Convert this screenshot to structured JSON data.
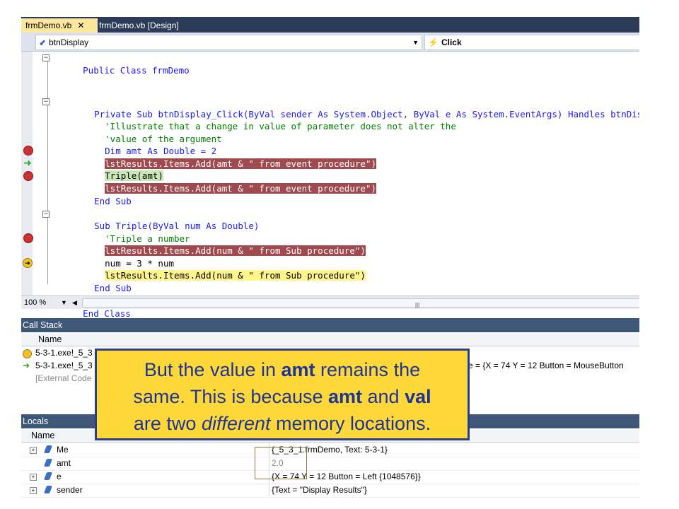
{
  "tabs": [
    {
      "label": "frmDemo.vb",
      "close": "✕",
      "active": true
    },
    {
      "label": "frmDemo.vb [Design]",
      "active": false
    }
  ],
  "navbar": {
    "object_combo": "btnDisplay",
    "event_combo": "Click"
  },
  "code": {
    "lines": [
      {
        "text": "Public Class frmDemo"
      },
      {
        "text": ""
      },
      {
        "text": "Private Sub btnDisplay_Click(ByVal sender As System.Object, ByVal e As System.EventArgs) Handles btnDispla"
      },
      {
        "text": "'Illustrate that a change in value of parameter does not alter the"
      },
      {
        "text": "'value of the argument"
      },
      {
        "text": "Dim amt As Double = 2"
      },
      {
        "text": "lstResults.Items.Add(amt & \" from event procedure\")"
      },
      {
        "text": "Triple(amt)"
      },
      {
        "text": "lstResults.Items.Add(amt & \" from event procedure\")"
      },
      {
        "text": "End Sub"
      },
      {
        "text": ""
      },
      {
        "text": "Sub Triple(ByVal num As Double)"
      },
      {
        "text": "'Triple a number"
      },
      {
        "text": "lstResults.Items.Add(num & \" from Sub procedure\")"
      },
      {
        "text": "num = 3 * num"
      },
      {
        "text": "lstResults.Items.Add(num & \" from Sub procedure\")"
      },
      {
        "text": "End Sub"
      },
      {
        "text": ""
      },
      {
        "text": "End Class"
      }
    ]
  },
  "zoom": "100 %",
  "callstack": {
    "title": "Call Stack",
    "column": "Name",
    "rows": [
      {
        "name": "5-3-1.exe!_5_3",
        "tail": ""
      },
      {
        "name": "5-3-1.exe!_5_3",
        "tail": "e = {X = 74 Y = 12 Button = MouseButton"
      },
      {
        "name": "[External Code",
        "tail": ""
      }
    ]
  },
  "locals": {
    "title": "Locals",
    "column": "Name",
    "rows": [
      {
        "name": "Me",
        "value": "{_5_3_1.frmDemo, Text: 5-3-1}",
        "expandable": true
      },
      {
        "name": "amt",
        "value": "2.0",
        "expandable": false
      },
      {
        "name": "e",
        "value": "{X = 74 Y = 12 Button = Left {1048576}}",
        "expandable": true
      },
      {
        "name": "sender",
        "value": "{Text = \"Display Results\"}",
        "expandable": true
      }
    ]
  },
  "callout": {
    "line1_a": "But the value in ",
    "line1_b": "amt",
    "line1_c": " remains the",
    "line2_a": "same. This is because ",
    "line2_b": "amt",
    "line2_c": " and ",
    "line2_d": "val",
    "line3_a": "are two ",
    "line3_b": "different",
    "line3_c": " memory locations."
  },
  "colors": {
    "breakpoint_highlight": "#a04a50",
    "current_statement": "#fff58a",
    "callout_bg": "#fed738",
    "callout_text": "#1f3596"
  }
}
